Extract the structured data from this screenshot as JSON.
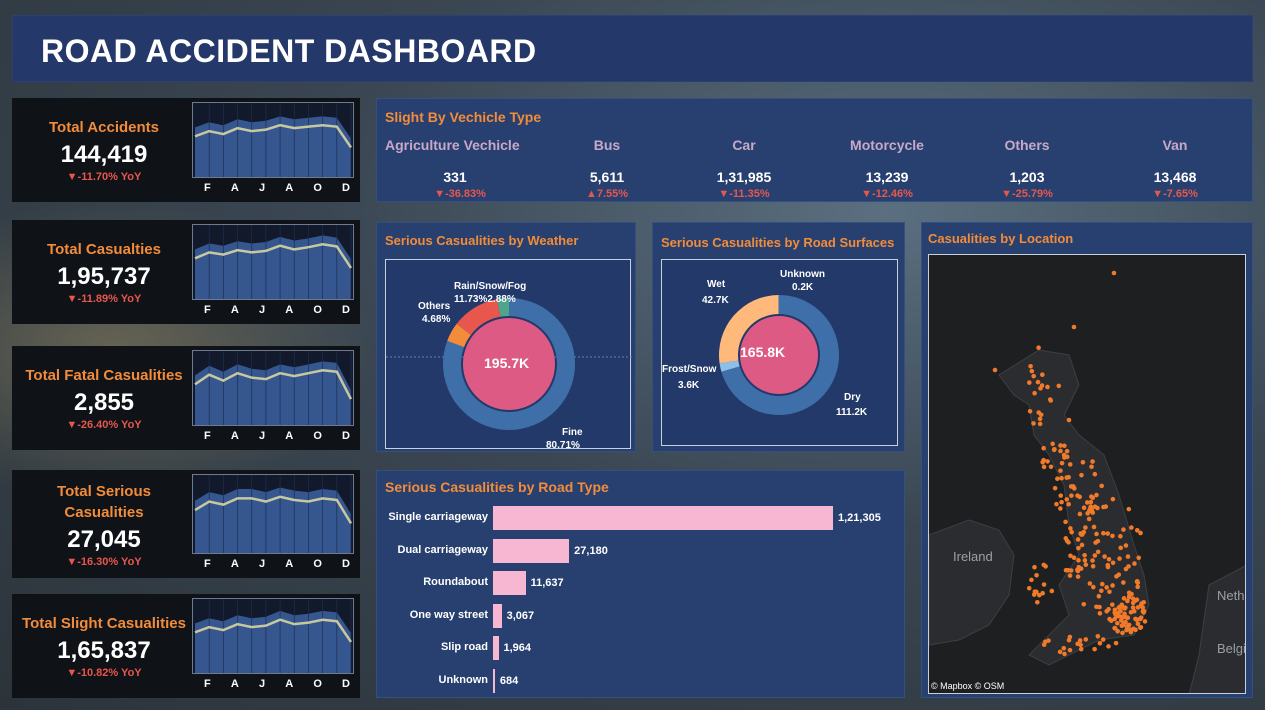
{
  "title": "ROAD ACCIDENT DASHBOARD",
  "colors": {
    "accent": "#f28c3b",
    "down": "#e8574e",
    "up": "#e8574e",
    "panel": "#27406f",
    "bar": "#f7b6d2"
  },
  "months": [
    "F",
    "A",
    "J",
    "A",
    "O",
    "D"
  ],
  "kpis": [
    {
      "label": "Total Accidents",
      "value": "144,419",
      "yoy": "▼-11.70% YoY",
      "trend": [
        0.55,
        0.62,
        0.58,
        0.66,
        0.62,
        0.64,
        0.7,
        0.66,
        0.68,
        0.7,
        0.68,
        0.4
      ]
    },
    {
      "label": "Total Casualties",
      "value": "1,95,737",
      "yoy": "▼-11.89% YoY",
      "trend": [
        0.55,
        0.63,
        0.6,
        0.66,
        0.63,
        0.65,
        0.72,
        0.67,
        0.7,
        0.74,
        0.71,
        0.42
      ]
    },
    {
      "label": "Total Fatal Casualities",
      "value": "2,855",
      "yoy": "▼-26.40% YoY",
      "trend": [
        0.55,
        0.68,
        0.6,
        0.7,
        0.64,
        0.62,
        0.7,
        0.66,
        0.7,
        0.74,
        0.72,
        0.35
      ]
    },
    {
      "label": "Total Serious Casualities",
      "value": "27,045",
      "yoy": "▼-16.30% YoY",
      "trend": [
        0.55,
        0.66,
        0.62,
        0.7,
        0.7,
        0.66,
        0.72,
        0.68,
        0.66,
        0.7,
        0.68,
        0.38
      ]
    },
    {
      "label": "Total Slight Casualities",
      "value": "1,65,837",
      "yoy": "▼-10.82% YoY",
      "trend": [
        0.55,
        0.62,
        0.58,
        0.66,
        0.62,
        0.64,
        0.72,
        0.66,
        0.68,
        0.72,
        0.7,
        0.42
      ]
    }
  ],
  "vehicle": {
    "title": "Slight By Vechicle Type",
    "items": [
      {
        "name": "Agriculture  Vechicle",
        "value": "331",
        "yoy": "▼-36.83%",
        "dir": "down"
      },
      {
        "name": "Bus",
        "value": "5,611",
        "yoy": "▲7.55%",
        "dir": "up"
      },
      {
        "name": "Car",
        "value": "1,31,985",
        "yoy": "▼-11.35%",
        "dir": "down"
      },
      {
        "name": "Motorcycle",
        "value": "13,239",
        "yoy": "▼-12.46%",
        "dir": "down"
      },
      {
        "name": "Others",
        "value": "1,203",
        "yoy": "▼-25.79%",
        "dir": "down"
      },
      {
        "name": "Van",
        "value": "13,468",
        "yoy": "▼-7.65%",
        "dir": "down"
      }
    ]
  },
  "weather": {
    "title": "Serious Casualities by Weather",
    "center": "195.7K",
    "slices": [
      {
        "label": "Fine",
        "pct": "80.71%",
        "value": 80.71,
        "color": "#3f6fa8"
      },
      {
        "label": "Others",
        "pct": "4.68%",
        "value": 4.68,
        "color": "#f28c3b"
      },
      {
        "label": "Rain",
        "pct": "11.73%",
        "value": 11.73,
        "color": "#e8574e"
      },
      {
        "label": "Snow/Fog",
        "pct": "2.88%",
        "value": 2.88,
        "color": "#4fa58a"
      }
    ],
    "label_rain_snow": "Rain",
    "label_snowfog": "Snow/Fog",
    "label_pcts": "11.73%2.88%"
  },
  "surface": {
    "title": "Serious Casualities by Road Surfaces",
    "center": "165.8K",
    "slices": [
      {
        "label": "Dry",
        "value_text": "111.2K",
        "value": 111.2,
        "color": "#3f6fa8"
      },
      {
        "label": "Frost/Snow",
        "value_text": "3.6K",
        "value": 3.6,
        "color": "#8cc0e8"
      },
      {
        "label": "Wet",
        "value_text": "42.7K",
        "value": 42.7,
        "color": "#ffb97a"
      },
      {
        "label": "Unknown",
        "value_text": "0.2K",
        "value": 0.2,
        "color": "#3f6fa8"
      }
    ]
  },
  "location": {
    "title": "Casualities by Location",
    "ireland": "Ireland",
    "neth": "Neth",
    "belg": "Belgi",
    "credit": "© Mapbox  © OSM"
  },
  "chart_data": {
    "type": "bar",
    "title": "Serious Casualities by Road Type",
    "categories": [
      "Single carriageway",
      "Dual carriageway",
      "Roundabout",
      "One way street",
      "Slip road",
      "Unknown"
    ],
    "values": [
      121305,
      27180,
      11637,
      3067,
      1964,
      684
    ],
    "labels": [
      "1,21,305",
      "27,180",
      "11,637",
      "3,067",
      "1,964",
      "684"
    ]
  }
}
